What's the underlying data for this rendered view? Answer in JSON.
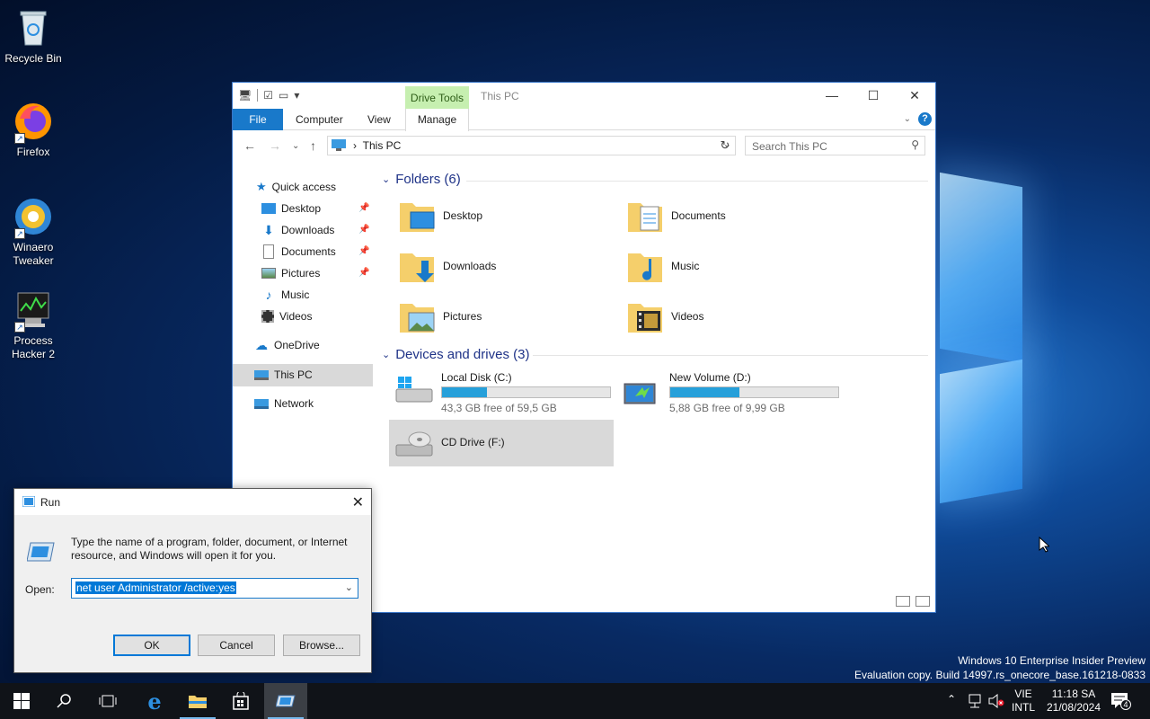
{
  "desktop": {
    "icons": [
      {
        "label": "Recycle Bin"
      },
      {
        "label": "Firefox"
      },
      {
        "label": "Winaero Tweaker"
      },
      {
        "label": "Process Hacker 2"
      }
    ]
  },
  "explorer": {
    "contextual_tab": "Drive Tools",
    "title": "This PC",
    "tabs": [
      "File",
      "Computer",
      "View",
      "Manage"
    ],
    "address_crumb": "This PC",
    "search_placeholder": "Search This PC",
    "nav": {
      "quick_access": "Quick access",
      "items": [
        "Desktop",
        "Downloads",
        "Documents",
        "Pictures",
        "Music",
        "Videos"
      ],
      "onedrive": "OneDrive",
      "this_pc": "This PC",
      "network": "Network"
    },
    "folders_header": "Folders (6)",
    "folders": [
      "Desktop",
      "Documents",
      "Downloads",
      "Music",
      "Pictures",
      "Videos"
    ],
    "drives_header": "Devices and drives (3)",
    "drives": [
      {
        "name": "Local Disk (C:)",
        "free_text": "43,3 GB free of 59,5 GB",
        "used_fraction": 0.27
      },
      {
        "name": "New Volume (D:)",
        "free_text": "5,88 GB free of 9,99 GB",
        "used_fraction": 0.41
      },
      {
        "name": "CD Drive (F:)"
      }
    ]
  },
  "run": {
    "title": "Run",
    "description": "Type the name of a program, folder, document, or Internet resource, and Windows will open it for you.",
    "open_label": "Open:",
    "open_value": "net user Administrator /active:yes",
    "ok": "OK",
    "cancel": "Cancel",
    "browse": "Browse..."
  },
  "watermark": {
    "line1": "Windows 10 Enterprise Insider Preview",
    "line2": "Evaluation copy. Build 14997.rs_onecore_base.161218-0833"
  },
  "taskbar": {
    "lang_line1": "VIE",
    "lang_line2": "INTL",
    "time": "11:18 SA",
    "date": "21/08/2024",
    "notification_count": "4"
  },
  "colors": {
    "accent": "#1979ca",
    "drive_fill": "#26a0da",
    "drive_tools": "#c6efb0",
    "group_header": "#1e3287"
  }
}
